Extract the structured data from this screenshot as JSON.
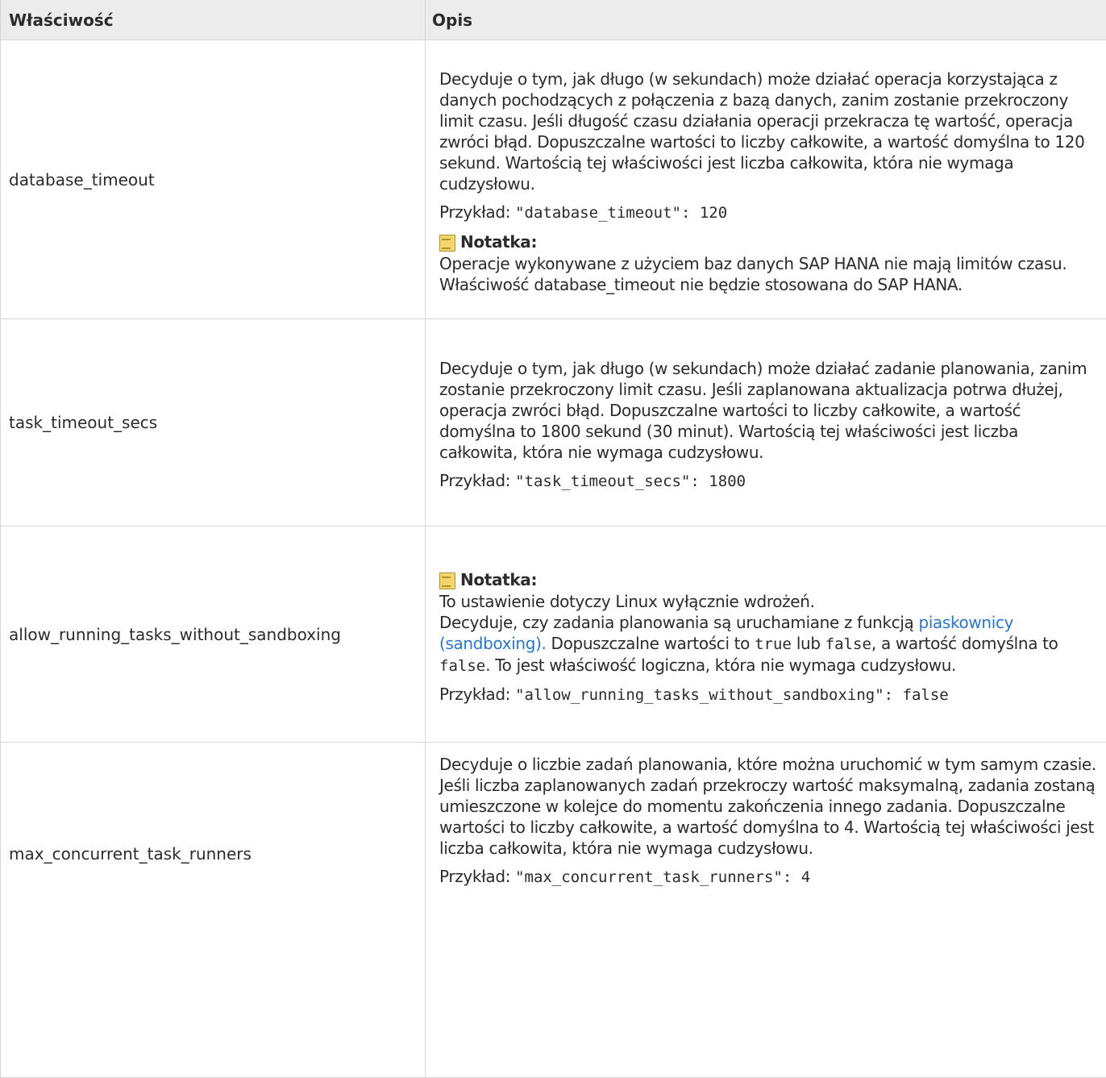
{
  "header": {
    "property": "Właściwość",
    "description": "Opis"
  },
  "example_label": "Przykład: ",
  "note_label": "Notatka:",
  "rows": [
    {
      "name": "database_timeout",
      "text": "Decyduje o tym, jak długo (w sekundach) może działać operacja korzystająca z danych pochodzących z połączenia z bazą danych, zanim zostanie przekroczony limit czasu. Jeśli długość czasu działania operacji przekracza tę wartość, operacja zwróci błąd. Dopuszczalne wartości to liczby całkowite, a wartość domyślna to 120 sekund. Wartością tej właściwości jest liczba całkowita, która nie wymaga cudzysłowu.",
      "example": "\"database_timeout\": 120",
      "note": "Operacje wykonywane z użyciem baz danych SAP HANA nie mają limitów czasu. Właściwość database_timeout nie będzie stosowana do SAP HANA."
    },
    {
      "name": "task_timeout_secs",
      "text": "Decyduje o tym, jak długo (w sekundach) może działać zadanie planowania, zanim zostanie przekroczony limit czasu. Jeśli zaplanowana aktualizacja potrwa dłużej, operacja zwróci błąd. Dopuszczalne wartości to liczby całkowite, a wartość domyślna to 1800 sekund (30 minut). Wartością tej właściwości jest liczba całkowita, która nie wymaga cudzysłowu.",
      "example": "\"task_timeout_secs\": 1800"
    },
    {
      "name": "allow_running_tasks_without_sandboxing",
      "note": "To ustawienie dotyczy Linux wyłącznie wdrożeń.",
      "text_a": "Decyduje, czy zadania planowania są uruchamiane z funkcją ",
      "link": "piaskownicy (sandboxing).",
      "text_b": " Dopuszczalne wartości to ",
      "code_true": "true",
      "text_c": " lub ",
      "code_false_1": "false",
      "text_d": ", a wartość domyślna to ",
      "code_false_2": "false",
      "text_e": ". To jest właściwość logiczna, która nie wymaga cudzysłowu.",
      "example": "\"allow_running_tasks_without_sandboxing\": false"
    },
    {
      "name": "max_concurrent_task_runners",
      "text": "Decyduje o liczbie zadań planowania, które można uruchomić w tym samym czasie. Jeśli liczba zaplanowanych zadań przekroczy wartość maksymalną, zadania zostaną umieszczone w kolejce do momentu zakończenia innego zadania. Dopuszczalne wartości to liczby całkowite, a wartość domyślna to 4. Wartością tej właściwości jest liczba całkowita, która nie wymaga cudzysłowu.",
      "example": "\"max_concurrent_task_runners\": 4"
    }
  ]
}
